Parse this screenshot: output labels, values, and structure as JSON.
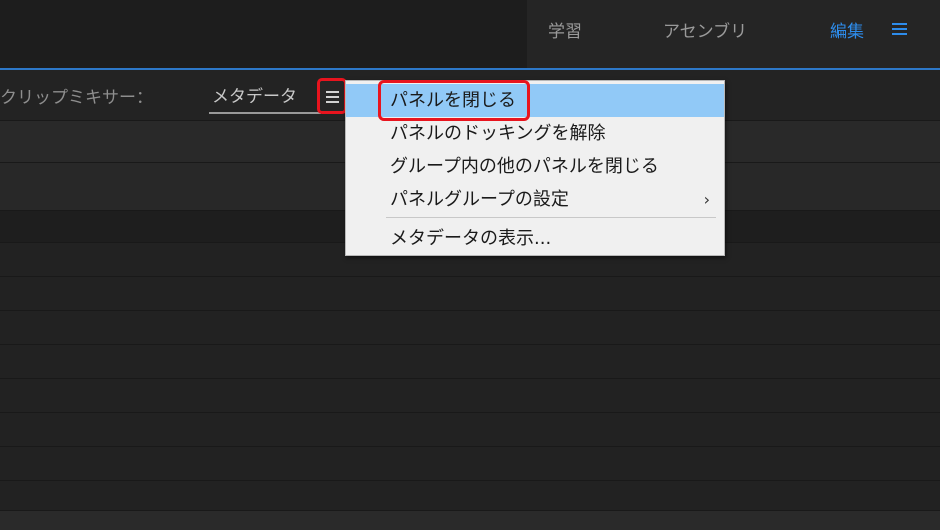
{
  "workspace": {
    "tabs": [
      "学習",
      "アセンブリ",
      "編集"
    ],
    "active_tab": "編集",
    "accent_color": "#2d8ceb"
  },
  "panel": {
    "tabs": [
      "クリップミキサー：",
      "メタデータ"
    ],
    "menu_icon": "hamburger-icon"
  },
  "context_menu": {
    "items": [
      {
        "label": "パネルを閉じる",
        "highlighted": true
      },
      {
        "label": "パネルのドッキングを解除"
      },
      {
        "label": "グループ内の他のパネルを閉じる"
      },
      {
        "label": "パネルグループの設定",
        "submenu_arrow": "›"
      },
      {
        "label": "メタデータの表示..."
      }
    ]
  },
  "annotation_color": "#e8141e"
}
